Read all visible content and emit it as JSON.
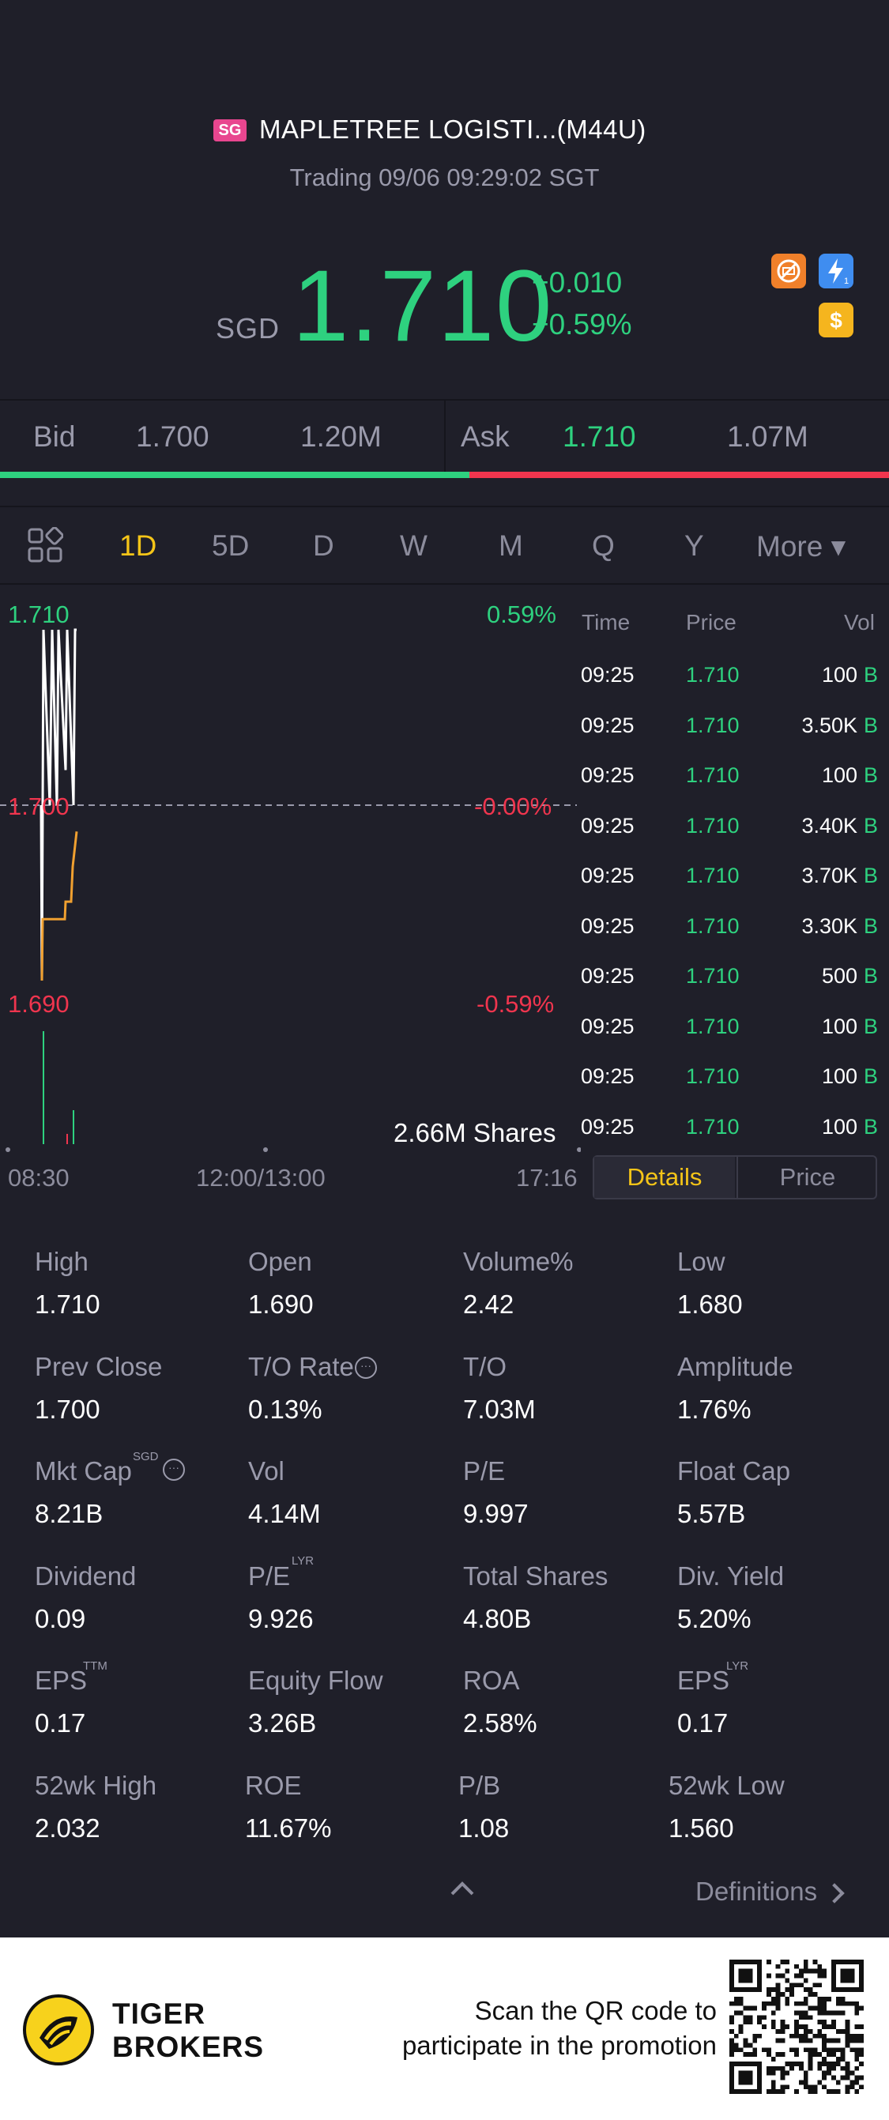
{
  "header": {
    "market_badge": "SG",
    "stock_name": "MAPLETREE LOGISTI...(M44U)",
    "status": "Trading 09/06 09:29:02 SGT",
    "currency": "SGD",
    "price": "1.710",
    "change": "+0.010",
    "change_pct": "+0.59%"
  },
  "bidask": {
    "bid_label": "Bid",
    "bid_price": "1.700",
    "bid_size": "1.20M",
    "ask_label": "Ask",
    "ask_price": "1.710",
    "ask_size": "1.07M",
    "bid_ratio": 0.528
  },
  "tabs": [
    "1D",
    "5D",
    "D",
    "W",
    "M",
    "Q",
    "Y"
  ],
  "tabs_more": "More ▾",
  "active_tab": "1D",
  "chart": {
    "high_price": "1.710",
    "high_pct": "0.59%",
    "mid_price": "1.700",
    "mid_pct": "-0.00%",
    "low_price": "1.690",
    "low_pct": "-0.59%",
    "volume": "2.66M Shares",
    "x_start": "08:30",
    "x_mid": "12:00/13:00",
    "x_end": "17:16"
  },
  "chart_data": {
    "type": "line",
    "ylim": [
      1.69,
      1.71
    ],
    "series": [
      {
        "values": [
          1.7,
          1.69,
          1.71,
          1.7,
          1.71,
          1.7,
          1.71,
          1.702,
          1.71,
          1.7,
          1.71
        ]
      },
      {
        "values": [
          1.69,
          1.6935,
          1.6935,
          1.6945,
          1.6945,
          1.6965,
          1.6985
        ]
      }
    ]
  },
  "trades": {
    "headers": {
      "time": "Time",
      "price": "Price",
      "vol": "Vol"
    },
    "rows": [
      {
        "time": "09:25",
        "price": "1.710",
        "vol": "100",
        "side": "B"
      },
      {
        "time": "09:25",
        "price": "1.710",
        "vol": "3.50K",
        "side": "B"
      },
      {
        "time": "09:25",
        "price": "1.710",
        "vol": "100",
        "side": "B"
      },
      {
        "time": "09:25",
        "price": "1.710",
        "vol": "3.40K",
        "side": "B"
      },
      {
        "time": "09:25",
        "price": "1.710",
        "vol": "3.70K",
        "side": "B"
      },
      {
        "time": "09:25",
        "price": "1.710",
        "vol": "3.30K",
        "side": "B"
      },
      {
        "time": "09:25",
        "price": "1.710",
        "vol": "500",
        "side": "B"
      },
      {
        "time": "09:25",
        "price": "1.710",
        "vol": "100",
        "side": "B"
      },
      {
        "time": "09:25",
        "price": "1.710",
        "vol": "100",
        "side": "B"
      },
      {
        "time": "09:25",
        "price": "1.710",
        "vol": "100",
        "side": "B"
      }
    ]
  },
  "toggle": {
    "details": "Details",
    "price": "Price"
  },
  "stats": [
    [
      {
        "label": "High",
        "value": "1.710"
      },
      {
        "label": "Open",
        "value": "1.690"
      },
      {
        "label": "Volume%",
        "value": "2.42"
      },
      {
        "label": "Low",
        "value": "1.680"
      }
    ],
    [
      {
        "label": "Prev Close",
        "value": "1.700"
      },
      {
        "label": "T/O Rate",
        "value": "0.13%"
      },
      {
        "label": "T/O",
        "value": "7.03M"
      },
      {
        "label": "Amplitude",
        "value": "1.76%"
      }
    ],
    [
      {
        "label": "Mkt Cap",
        "value": "8.21B"
      },
      {
        "label": "Vol",
        "value": "4.14M"
      },
      {
        "label": "P/E",
        "value": "9.997"
      },
      {
        "label": "Float Cap",
        "value": "5.57B"
      }
    ],
    [
      {
        "label": "Dividend",
        "value": "0.09"
      },
      {
        "label": "P/E",
        "value": "9.926"
      },
      {
        "label": "Total Shares",
        "value": "4.80B"
      },
      {
        "label": "Div. Yield",
        "value": "5.20%"
      }
    ],
    [
      {
        "label": "EPS",
        "value": "0.17"
      },
      {
        "label": "Equity Flow",
        "value": "3.26B"
      },
      {
        "label": "ROA",
        "value": "2.58%"
      },
      {
        "label": "EPS",
        "value": "0.17"
      }
    ],
    [
      {
        "label": "52wk High",
        "value": "2.032"
      },
      {
        "label": "ROE",
        "value": "11.67%"
      },
      {
        "label": "P/B",
        "value": "1.08"
      },
      {
        "label": "52wk Low",
        "value": "1.560"
      }
    ]
  ],
  "superscripts": {
    "mktcap": "SGD",
    "pe_lyr": "LYR",
    "eps_ttm": "TTM",
    "eps_lyr": "LYR"
  },
  "definitions": "Definitions",
  "footer": {
    "brand_line1": "TIGER",
    "brand_line2": "BROKERS",
    "promo_line1": "Scan the QR code to",
    "promo_line2": "participate in the promotion"
  },
  "colors": {
    "up": "#2ed17f",
    "down": "#f0354e",
    "accent": "#f5c518",
    "bg": "#1f1f29"
  }
}
